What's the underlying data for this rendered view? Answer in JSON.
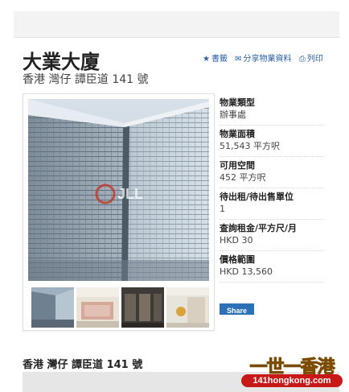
{
  "property": {
    "name": "大業大廈",
    "address": "香港 灣仔 譚臣道 141 號"
  },
  "actions": [
    {
      "icon": "star-icon",
      "glyph": "★",
      "label": "書籤"
    },
    {
      "icon": "mail-icon",
      "glyph": "✉",
      "label": "分享物業資料"
    },
    {
      "icon": "print-icon",
      "glyph": "⎙",
      "label": "列印"
    }
  ],
  "photo": {
    "watermark": "JLL"
  },
  "facts": [
    {
      "label": "物業類型",
      "value": "辦事處"
    },
    {
      "label": "物業面積",
      "value": "51,543 平方呎"
    },
    {
      "label": "可用空間",
      "value": "452 平方呎"
    },
    {
      "label": "待出租/待出售單位",
      "value": "1"
    },
    {
      "label": "查詢租金/平方尺/月",
      "value": "HKD 30"
    },
    {
      "label": "價格範圍",
      "value": "HKD 13,560"
    }
  ],
  "share": {
    "label": "Share"
  },
  "location": {
    "heading": "香港 灣仔 譚臣道 141 號"
  },
  "site_watermark": {
    "top": "一世一香港",
    "bottom": "141hongkong.com"
  },
  "colors": {
    "link": "#2a62a8",
    "share_button": "#2c70b8",
    "watermark_gold": "#f7c51a",
    "watermark_red": "#c81818"
  }
}
